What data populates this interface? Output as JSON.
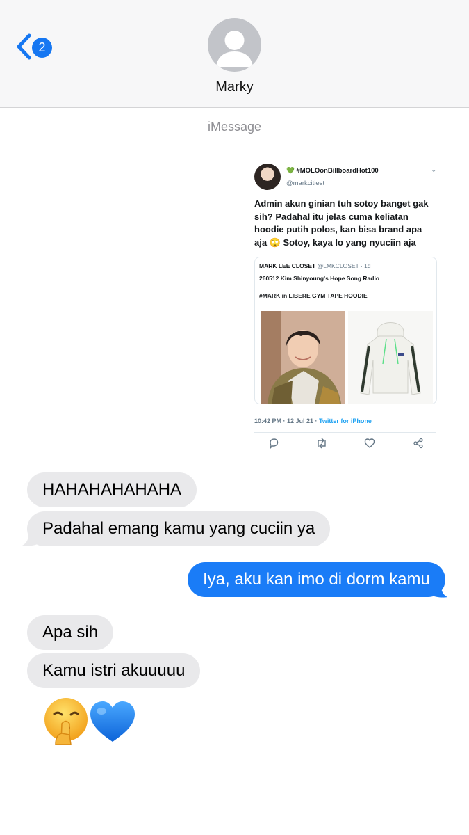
{
  "header": {
    "unread_count": "2",
    "contact_name": "Marky",
    "service_label": "iMessage"
  },
  "tweet": {
    "display_name": "💚 #MOLOonBillboardHot100",
    "handle": "@markcitiest",
    "text": "Admin akun ginian tuh sotoy banget gak sih? Padahal itu jelas cuma keliatan hoodie putih polos, kan bisa brand apa aja 🙄 Sotoy, kaya lo yang nyuciin aja",
    "quote": {
      "user": "MARK LEE CLOSET",
      "handle_time": "@LMKCLOSET · 1d",
      "line1": "260512 Kim Shinyoung's Hope Song Radio",
      "line2": "#MARK in LIBERE GYM TAPE HOODIE"
    },
    "timestamp": "10:42 PM · 12 Jul 21 · ",
    "source": "Twitter for iPhone"
  },
  "messages": [
    {
      "side": "received",
      "text": "HAHAHAHAHAHA"
    },
    {
      "side": "received",
      "text": "Padahal emang kamu yang cuciin ya"
    },
    {
      "side": "sent",
      "text": "Iya, aku kan imo di dorm kamu"
    },
    {
      "side": "received",
      "text": "Apa sih"
    },
    {
      "side": "received",
      "text": "Kamu istri akuuuuu"
    },
    {
      "side": "received",
      "text": "🤫💙"
    }
  ],
  "colors": {
    "accent": "#1a7cf7",
    "received_bubble": "#e9e9eb",
    "header_bg": "#f7f7f8",
    "muted": "#8e8e93"
  }
}
